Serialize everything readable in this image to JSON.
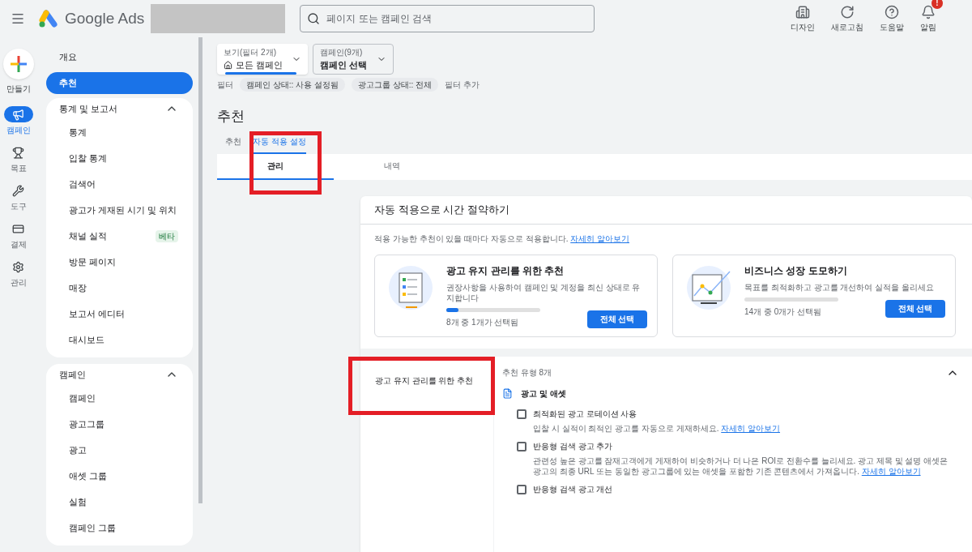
{
  "header": {
    "brand": "Google Ads",
    "search": {
      "placeholder": "페이지 또는 캠페인 검색"
    },
    "actions": [
      {
        "label": "디자인",
        "alert": false
      },
      {
        "label": "새로고침",
        "alert": false
      },
      {
        "label": "도움말",
        "alert": false
      },
      {
        "label": "알림",
        "alert": true,
        "badge": "!"
      }
    ]
  },
  "rail": {
    "create": "만들기",
    "items": [
      {
        "label": "캠페인",
        "selected": true
      },
      {
        "label": "목표",
        "selected": false
      },
      {
        "label": "도구",
        "selected": false
      },
      {
        "label": "결제",
        "selected": false
      },
      {
        "label": "관리",
        "selected": false
      }
    ]
  },
  "nav": {
    "top_items": [
      {
        "label": "개요",
        "selected": false
      },
      {
        "label": "추천",
        "selected": true
      }
    ],
    "groups": [
      {
        "title": "통계 및 보고서",
        "expanded": true,
        "items": [
          {
            "label": "통계"
          },
          {
            "label": "입찰 통계"
          },
          {
            "label": "검색어"
          },
          {
            "label": "광고가 게재된 시기 및 위치"
          },
          {
            "label": "채널 실적",
            "badge": "베타"
          },
          {
            "label": "방문 페이지"
          },
          {
            "label": "매장"
          },
          {
            "label": "보고서 에디터"
          },
          {
            "label": "대시보드"
          }
        ]
      },
      {
        "title": "캠페인",
        "expanded": true,
        "items": [
          {
            "label": "캠페인"
          },
          {
            "label": "광고그룹"
          },
          {
            "label": "광고"
          },
          {
            "label": "애셋 그룹"
          },
          {
            "label": "실험"
          },
          {
            "label": "캠페인 그룹"
          }
        ]
      }
    ]
  },
  "filters": {
    "view": {
      "label": "보기(필터 2개)",
      "value": "모든 캠페인"
    },
    "campaign": {
      "label": "캠페인(9개)",
      "value": "캠페인 선택"
    },
    "filter_label": "필터",
    "chips": [
      "캠페인 상태:: 사용 설정됨",
      "광고그룹 상태:: 전체"
    ],
    "add": "필터 추가"
  },
  "page_title": "추천",
  "tabs": [
    {
      "label": "추천",
      "selected": false
    },
    {
      "label": "자동 적용 설정",
      "selected": true
    }
  ],
  "subtabs": [
    {
      "label": "관리",
      "selected": true
    },
    {
      "label": "내역",
      "selected": false
    }
  ],
  "panel": {
    "title": "자동 적용으로 시간 절약하기",
    "description": "적용 가능한 추천이 있을 때마다 자동으로 적용합니다.",
    "link": "자세히 알아보기",
    "cards": [
      {
        "title": "광고 유지 관리를 위한 추천",
        "description": "권장사항을 사용하여 캠페인 및 계정을 최신 상태로 유지합니다",
        "level": 0.125,
        "progress": "8개 중 1개가 선택됨",
        "button": "전체 선택"
      },
      {
        "title": "비즈니스 성장 도모하기",
        "description": "목표를 최적화하고 광고를 개선하여 실적을 올리세요",
        "progress": "14개 중 0개가 선택됨",
        "button": "전체 선택"
      }
    ]
  },
  "section": {
    "side_title": "광고 유지 관리를 위한 추천",
    "count": "추천 유형 8개",
    "expanded": true,
    "category": "광고 및 애셋",
    "options": [
      {
        "title": "최적화된 광고 로테이션 사용",
        "checked": false,
        "description": "입찰 시 실적이 최적인 광고를 자동으로 게재하세요.",
        "link": "자세히 알아보기"
      },
      {
        "title": "반응형 검색 광고 추가",
        "checked": false,
        "description": "관련성 높은 광고를 잠재고객에게 게재하여 비슷하거나 더 나은 ROI로 전환수를 늘리세요. 광고 제목 및 설명 애셋은 광고의 최종 URL 또는 동일한 광고그룹에 있는 애셋을 포함한 기존 콘텐츠에서 가져옵니다.",
        "link": "자세히 알아보기"
      },
      {
        "title": "반응형 검색 광고 개선",
        "checked": false
      }
    ]
  }
}
